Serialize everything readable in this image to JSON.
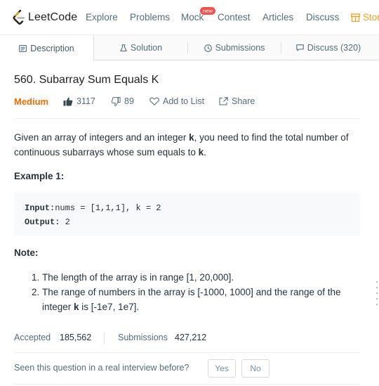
{
  "app": {
    "logo_text": "LeetCode",
    "nav": [
      {
        "label": "Explore"
      },
      {
        "label": "Problems"
      },
      {
        "label": "Mock",
        "badge": "new"
      },
      {
        "label": "Contest"
      },
      {
        "label": "Articles"
      },
      {
        "label": "Discuss"
      }
    ],
    "store_label": "Stor",
    "accent_color": "#f0a020",
    "badge_color": "#ef5350"
  },
  "tabs": [
    {
      "label": "Description",
      "icon": "document-icon",
      "active": true
    },
    {
      "label": "Solution",
      "icon": "flask-icon",
      "active": false
    },
    {
      "label": "Submissions",
      "icon": "clock-icon",
      "active": false
    },
    {
      "label": "Discuss (320)",
      "icon": "chat-icon",
      "active": false
    }
  ],
  "problem": {
    "title": "560. Subarray Sum Equals K",
    "difficulty": "Medium",
    "difficulty_color": "#ef6c00",
    "likes": "3117",
    "dislikes": "89",
    "add_to_list": "Add to List",
    "share": "Share",
    "description": {
      "part1": "Given an array of integers and an integer ",
      "k1": "k",
      "part2": ", you need to find the total number of continuous subarrays whose sum equals to ",
      "k2": "k",
      "part3": "."
    },
    "example_heading": "Example 1:",
    "example": {
      "input_label": "Input:",
      "input_value": "nums = [1,1,1], k = 2",
      "output_label": "Output:",
      "output_value": " 2"
    },
    "note_heading": "Note:",
    "notes": [
      {
        "num": "1.",
        "text": "The length of the array is in range [1, 20,000]."
      },
      {
        "num": "2.",
        "text_before": "The range of numbers in the array is [-1000, 1000] and the range of the integer ",
        "k": "k",
        "text_after": " is [-1e7, 1e7]."
      }
    ]
  },
  "stats": {
    "accepted_label": "Accepted",
    "accepted_value": "185,562",
    "submissions_label": "Submissions",
    "submissions_value": "427,212"
  },
  "interview": {
    "question": "Seen this question in a real interview before?",
    "yes": "Yes",
    "no": "No"
  }
}
